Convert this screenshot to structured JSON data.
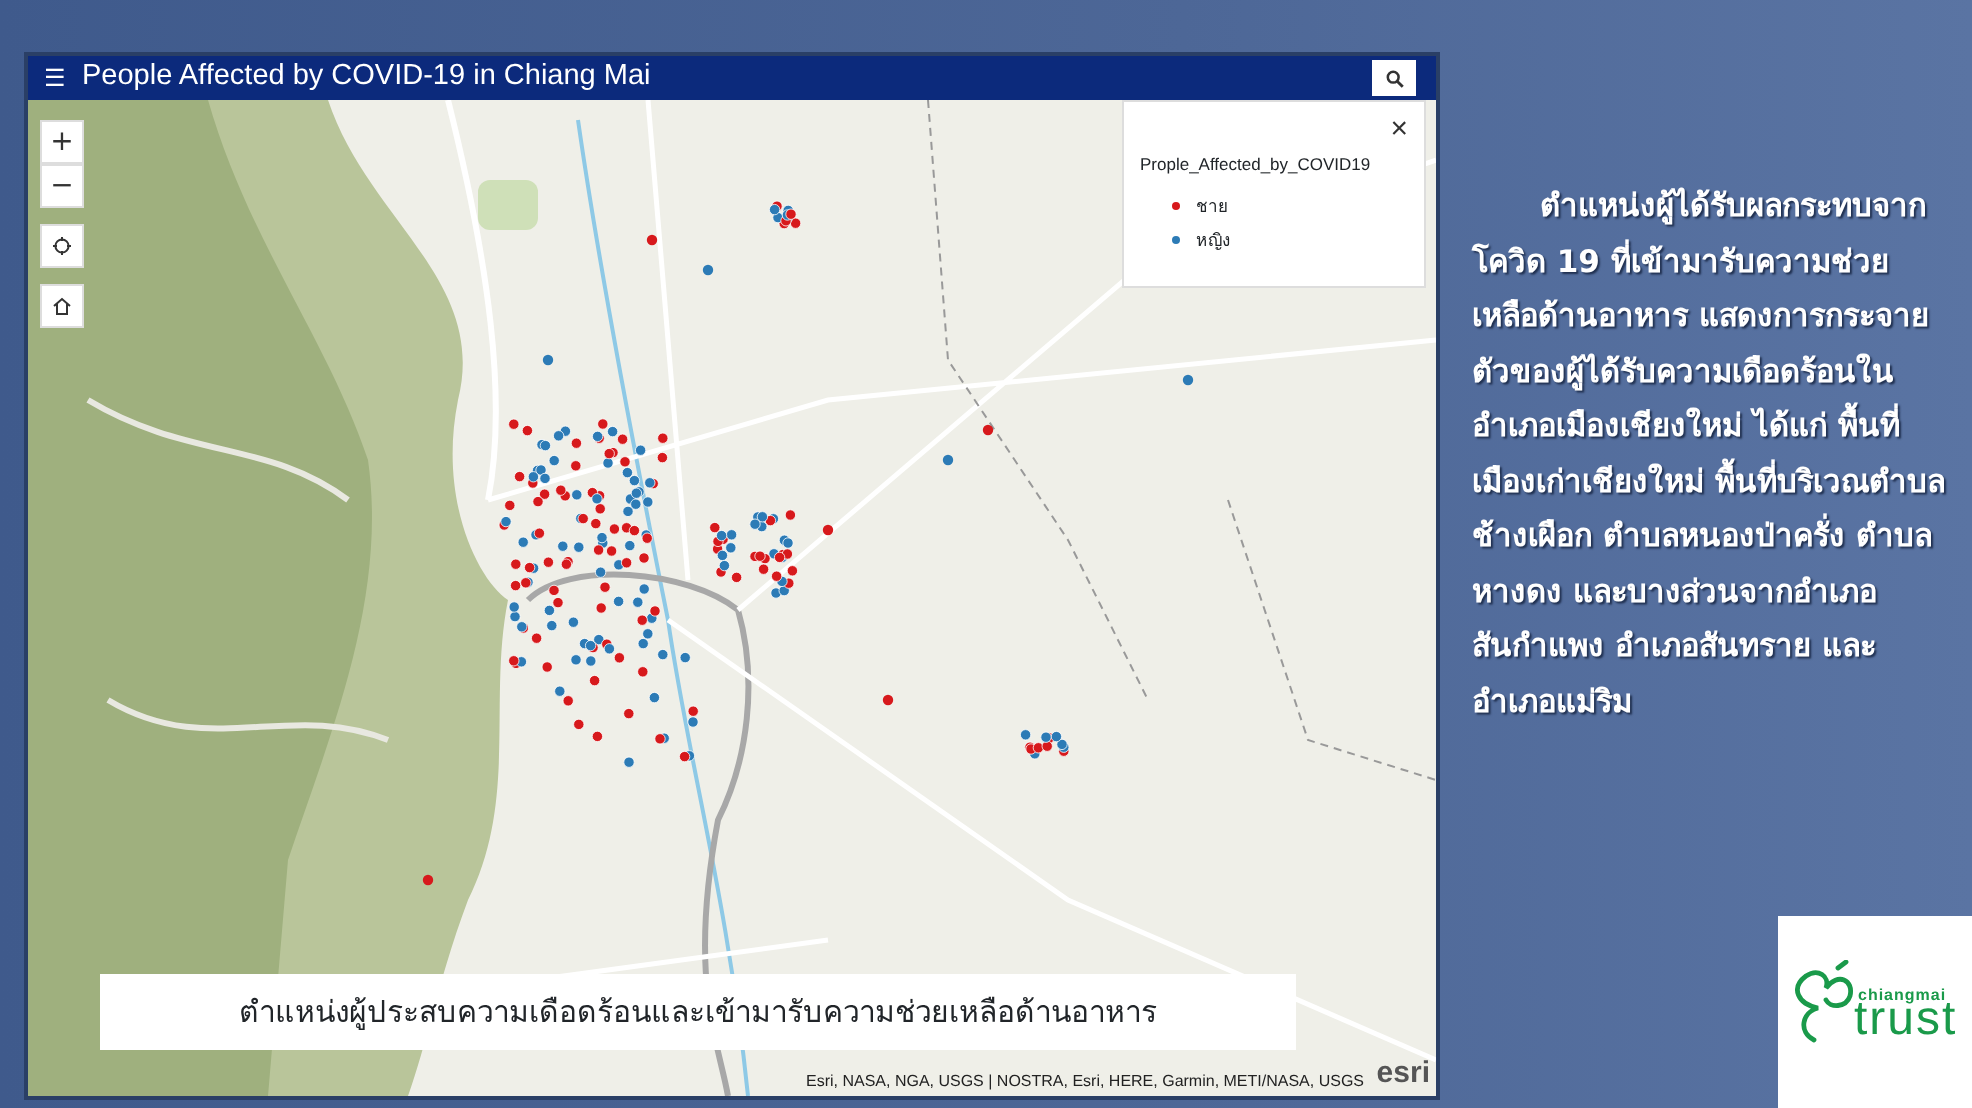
{
  "app": {
    "title": "People Affected by COVID-19 in Chiang Mai",
    "menu_glyph": "☰"
  },
  "map_controls": [
    {
      "kind": "zoom-in",
      "label": "+"
    },
    {
      "kind": "zoom-out",
      "label": "−"
    },
    {
      "kind": "locate"
    },
    {
      "kind": "home"
    }
  ],
  "legend": {
    "title": "Prople_Affected_by_COVID19",
    "close_glyph": "×",
    "items": [
      {
        "label": "ชาย",
        "color": "#d7191c"
      },
      {
        "label": "หญิง",
        "color": "#2c7bb6"
      }
    ]
  },
  "caption": "ตำแหน่งผู้ประสบความเดือดร้อนและเข้ามารับความช่วยเหลือด้านอาหาร",
  "attribution": "Esri, NASA, NGA, USGS | NOSTRA, Esri, HERE, Garmin, METI/NASA, USGS",
  "attribution_logo": "esri",
  "description": "ตำแหน่งผู้ได้รับผลกระทบจากโควิด 19 ที่เข้ามารับความช่วยเหลือด้านอาหาร แสดงการกระจายตัวของผู้ได้รับความเดือดร้อนในอำเภอเมืองเชียงใหม่ ได้แก่ พื้นที่เมืองเก่าเชียงใหม่ พื้นที่บริเวณตำบลช้างเผือก ตำบลหนองป่าครั่ง ตำบลหางดง และบางส่วนจากอำเภอสันกำแพง อำเภอสันทราย และ อำเภอแม่ริม",
  "logo": {
    "top": "chiangmai",
    "bottom": "trust"
  }
}
